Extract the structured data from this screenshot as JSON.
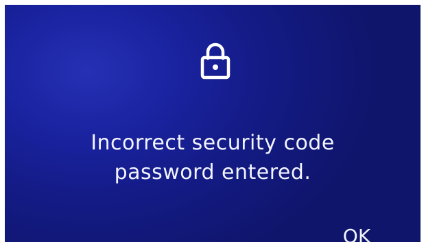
{
  "dialog": {
    "icon": "lock-icon",
    "message_line1": "Incorrect security code",
    "message_line2": "password entered.",
    "ok_label": "OK"
  },
  "colors": {
    "background_dark": "#0f156b",
    "background_light": "#2530b4",
    "text": "#f2f4ff"
  }
}
